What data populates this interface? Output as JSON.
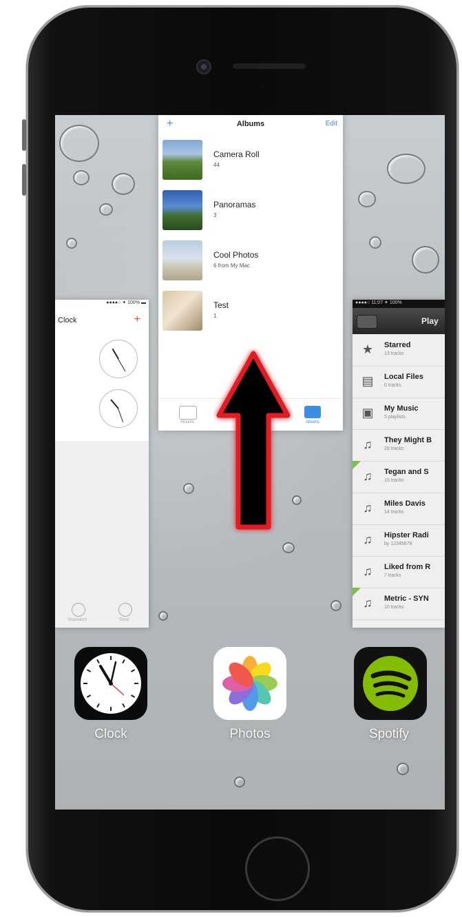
{
  "photos": {
    "nav_plus": "+",
    "nav_title": "Albums",
    "nav_edit": "Edit",
    "albums": [
      {
        "name": "Camera Roll",
        "count": "44"
      },
      {
        "name": "Panoramas",
        "count": "3"
      },
      {
        "name": "Cool Photos",
        "count": "6 from My Mac"
      },
      {
        "name": "Test",
        "count": "1"
      }
    ],
    "tabs": [
      {
        "label": "Albums"
      },
      {
        "label": "Albums"
      }
    ]
  },
  "clock": {
    "status": "●●●●○ ✦ 100% ▬",
    "title": "Clock",
    "plus": "+",
    "tabs": [
      {
        "label": "Stopwatch"
      },
      {
        "label": "Timer"
      }
    ]
  },
  "spotify": {
    "status": "●●●●○ 11:07 ✦ 100%",
    "title": "Play",
    "rows": [
      {
        "icon": "★",
        "name": "Starred",
        "sub": "13 tracks",
        "flag": false
      },
      {
        "icon": "▤",
        "name": "Local Files",
        "sub": "0 tracks",
        "flag": false
      },
      {
        "icon": "▣",
        "name": "My Music",
        "sub": "5 playlists",
        "flag": false
      },
      {
        "icon": "♫",
        "name": "They Might B",
        "sub": "28 tracks",
        "flag": false
      },
      {
        "icon": "♫",
        "name": "Tegan and S",
        "sub": "15 tracks",
        "flag": true
      },
      {
        "icon": "♫",
        "name": "Miles Davis",
        "sub": "14 tracks",
        "flag": false
      },
      {
        "icon": "♫",
        "name": "Hipster Radi",
        "sub": "by 12345678",
        "flag": false
      },
      {
        "icon": "♫",
        "name": "Liked from R",
        "sub": "7 tracks",
        "flag": false
      },
      {
        "icon": "♫",
        "name": "Metric - SYN",
        "sub": "10 tracks",
        "flag": true
      }
    ]
  },
  "dock": [
    {
      "label": "Clock",
      "icon": "clock-icon"
    },
    {
      "label": "Photos",
      "icon": "photos-icon"
    },
    {
      "label": "Spotify",
      "icon": "spotify-icon"
    }
  ],
  "colors": {
    "arrow": "#e11b22",
    "spotify_green": "#84bd00",
    "ios_blue": "#3a8ee6"
  }
}
